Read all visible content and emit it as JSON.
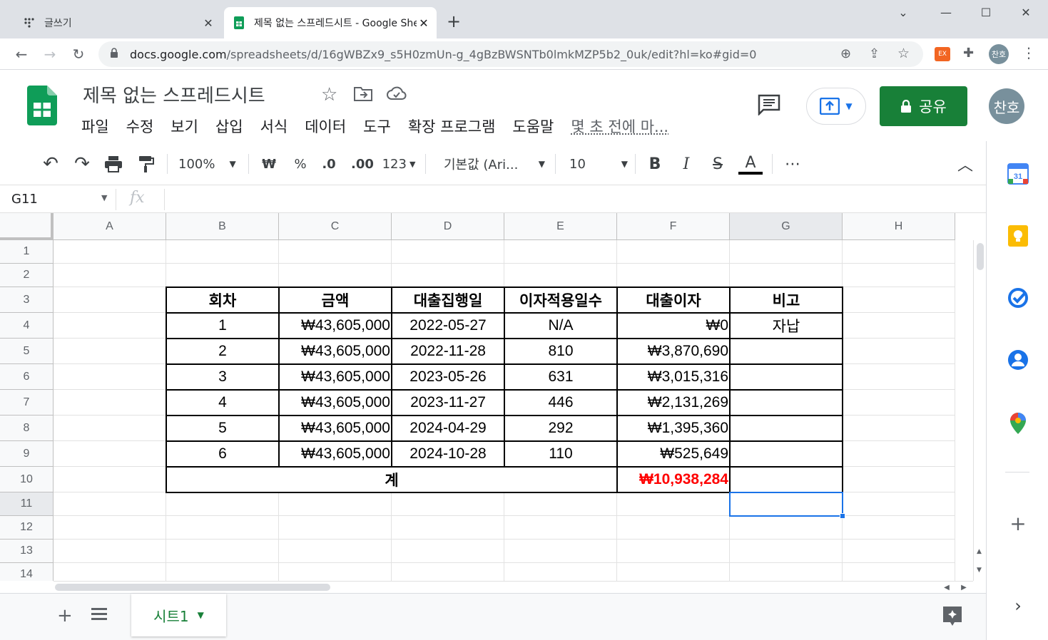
{
  "browser": {
    "tabs": [
      {
        "title": "글쓰기",
        "active": false
      },
      {
        "title": "제목 없는 스프레드시트 - Google Sheets",
        "active": true
      }
    ],
    "url_host": "docs.google.com",
    "url_path": "/spreadsheets/d/16gWBZx9_s5H0zmUn-g_4gBzBWSNTb0lmkMZP5b2_0uk/edit?hl=ko#gid=0",
    "profile_initial": "찬호",
    "ext_label": "EX"
  },
  "doc": {
    "title": "제목 없는 스프레드시트",
    "menu": [
      "파일",
      "수정",
      "보기",
      "삽입",
      "서식",
      "데이터",
      "도구",
      "확장 프로그램",
      "도움말"
    ],
    "last_edit": "몇 초 전에 마...",
    "share_label": "공유",
    "user_initial": "찬호"
  },
  "toolbar": {
    "zoom": "100%",
    "currency": "₩",
    "percent": "%",
    "dec_less": ".0",
    "dec_more": ".00",
    "format_more": "123",
    "font": "기본값 (Ari...",
    "font_size": "10",
    "bold": "B",
    "italic": "I",
    "strike": "S",
    "text_color": "A",
    "more": "⋯"
  },
  "formula_bar": {
    "name_box": "G11",
    "fx": "fx",
    "content": ""
  },
  "grid": {
    "columns": [
      "A",
      "B",
      "C",
      "D",
      "E",
      "F",
      "G",
      "H"
    ],
    "rows": [
      "1",
      "2",
      "3",
      "4",
      "5",
      "6",
      "7",
      "8",
      "9",
      "10",
      "11",
      "12",
      "13",
      "14"
    ],
    "selected_cell": "G11",
    "table": {
      "headers": [
        "회차",
        "금액",
        "대출집행일",
        "이자적용일수",
        "대출이자",
        "비고"
      ],
      "rows": [
        [
          "1",
          "₩43,605,000",
          "2022-05-27",
          "N/A",
          "₩0",
          "자납"
        ],
        [
          "2",
          "₩43,605,000",
          "2022-11-28",
          "810",
          "₩3,870,690",
          ""
        ],
        [
          "3",
          "₩43,605,000",
          "2023-05-26",
          "631",
          "₩3,015,316",
          ""
        ],
        [
          "4",
          "₩43,605,000",
          "2023-11-27",
          "446",
          "₩2,131,269",
          ""
        ],
        [
          "5",
          "₩43,605,000",
          "2024-04-29",
          "292",
          "₩1,395,360",
          ""
        ],
        [
          "6",
          "₩43,605,000",
          "2024-10-28",
          "110",
          "₩525,649",
          ""
        ]
      ],
      "total_label": "계",
      "total_value": "₩10,938,284",
      "total_color": "#ff0000"
    }
  },
  "sheets": {
    "active": "시트1"
  },
  "colors": {
    "sheets_green": "#188038",
    "selection_blue": "#1a73e8"
  }
}
